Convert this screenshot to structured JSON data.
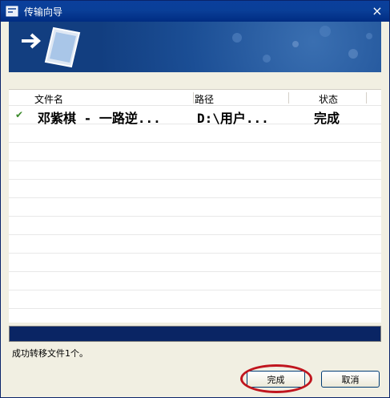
{
  "window": {
    "title": "传输向导",
    "close_glyph": "×"
  },
  "columns": [
    "文件名",
    "路径",
    "状态"
  ],
  "rows": [
    {
      "checked": true,
      "name": "邓紫棋 - 一路逆...",
      "path": "D:\\用户...",
      "status": "完成"
    }
  ],
  "progress_fraction": 1.0,
  "status_message": "成功转移文件1个。",
  "buttons": {
    "finish": "完成",
    "cancel": "取消"
  },
  "colors": {
    "titlebar": "#0a3f98",
    "banner": "#1b4e95",
    "progress": "#0a2564",
    "annotation": "#c0151e",
    "check": "#3a8a2a"
  },
  "icons": [
    "app-icon",
    "close-icon",
    "arrow-right-icon",
    "device-icon",
    "check-icon"
  ]
}
